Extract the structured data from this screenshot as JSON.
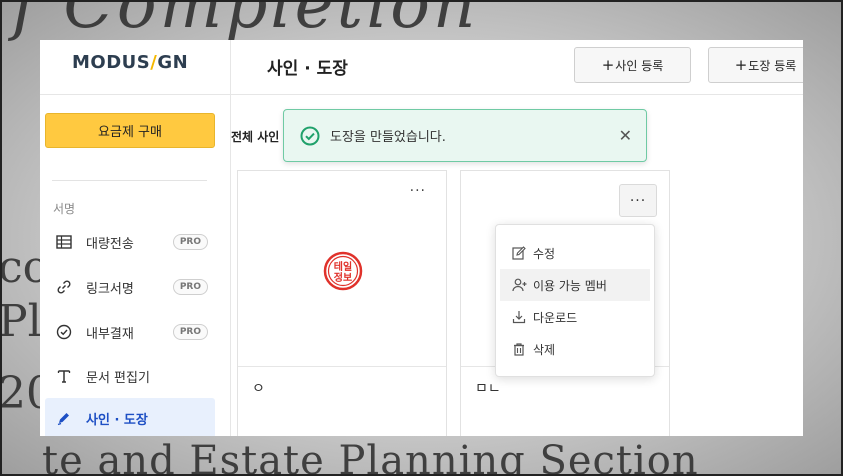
{
  "background": {
    "top_text": "f Completion",
    "bottom_text": "te and Estate Planning Section",
    "left_fragments": [
      "co",
      "Pl",
      "20"
    ]
  },
  "sidebar": {
    "logo_left": "MODUS",
    "logo_slash": "/",
    "logo_right": "GN",
    "buy_button": "요금제 구매",
    "section_label": "서명",
    "items": [
      {
        "label": "대량전송",
        "badge": "PRO",
        "icon": "table-icon"
      },
      {
        "label": "링크서명",
        "badge": "PRO",
        "icon": "link-icon"
      },
      {
        "label": "내부결재",
        "badge": "PRO",
        "icon": "check-circle-icon"
      },
      {
        "label": "문서 편집기",
        "badge": "",
        "icon": "text-icon"
      },
      {
        "label": "사인 · 도장",
        "badge": "",
        "icon": "pen-icon",
        "active": true
      }
    ]
  },
  "header": {
    "title": "사인 · 도장",
    "add_signature": "사인 등록",
    "add_stamp": "도장 등록",
    "plus": "+"
  },
  "content": {
    "total_label": "전체 사인",
    "cards": [
      {
        "name": "ㅇ",
        "menu_glyph": "···",
        "seal_text": "테일정보"
      },
      {
        "name": "ㅁㄴ",
        "menu_glyph": "···"
      }
    ]
  },
  "toast": {
    "message": "도장을 만들었습니다.",
    "close": "✕"
  },
  "menu": {
    "items": [
      {
        "label": "수정",
        "icon": "edit-icon"
      },
      {
        "label": "이용 가능 멤버",
        "icon": "user-plus-icon"
      },
      {
        "label": "다운로드",
        "icon": "download-icon"
      },
      {
        "label": "삭제",
        "icon": "trash-icon"
      }
    ]
  },
  "colors": {
    "accent": "#1d4fc4",
    "buy": "#ffc940",
    "toast_border": "#6fcaa4",
    "toast_icon": "#20a16b",
    "seal": "#e0322b"
  }
}
